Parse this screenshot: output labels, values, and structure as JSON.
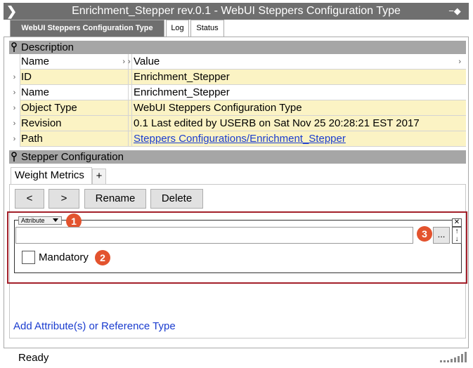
{
  "window": {
    "title": "Enrichment_Stepper rev.0.1 - WebUI Steppers Configuration Type"
  },
  "tabs": [
    {
      "label": "WebUI Steppers Configuration Type"
    },
    {
      "label": "Log"
    },
    {
      "label": "Status"
    }
  ],
  "description": {
    "header": "Description",
    "columns": {
      "name": "Name",
      "value": "Value"
    },
    "rows": [
      {
        "name": "ID",
        "value": "Enrichment_Stepper"
      },
      {
        "name": "Name",
        "value": "Enrichment_Stepper"
      },
      {
        "name": "Object Type",
        "value": "WebUI Steppers Configuration Type"
      },
      {
        "name": "Revision",
        "value": "0.1 Last edited by USERB on Sat Nov 25 20:28:21 EST 2017"
      },
      {
        "name": "Path",
        "value": "Steppers Configurations/Enrichment_Stepper"
      }
    ]
  },
  "stepper": {
    "header": "Stepper Configuration",
    "tab_label": "Weight Metrics",
    "add_tab": "+",
    "buttons": {
      "prev": "<",
      "next": ">",
      "rename": "Rename",
      "delete": "Delete"
    },
    "attribute_dropdown": "Attribute",
    "mandatory_label": "Mandatory",
    "dots": "...",
    "add_link": "Add Attribute(s) or Reference Type"
  },
  "callouts": [
    "1",
    "2",
    "3"
  ],
  "statusbar": {
    "text": "Ready"
  },
  "colors": {
    "titlebar": "#6f6f6f",
    "section": "#a6a6a6",
    "row_highlight": "#fbf3c4",
    "callout": "#e3532e",
    "highlight_box": "#a3202a",
    "link": "#1a3ccf"
  }
}
